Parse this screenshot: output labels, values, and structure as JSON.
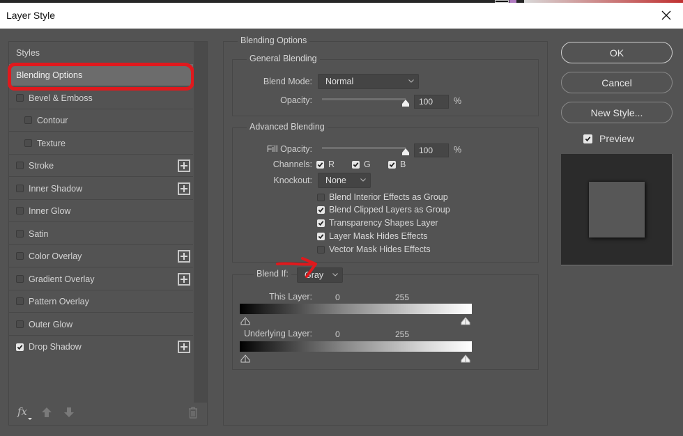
{
  "window": {
    "title": "Layer Style",
    "close_icon": "close-icon"
  },
  "sidebar": {
    "header": "Styles",
    "items": [
      {
        "label": "Blending Options",
        "type": "selected",
        "checkbox": false,
        "checked": false,
        "add": false
      },
      {
        "label": "Bevel & Emboss",
        "type": "item",
        "checkbox": true,
        "checked": false,
        "add": false
      },
      {
        "label": "Contour",
        "type": "sub",
        "checkbox": true,
        "checked": false,
        "add": false
      },
      {
        "label": "Texture",
        "type": "sub",
        "checkbox": true,
        "checked": false,
        "add": false
      },
      {
        "label": "Stroke",
        "type": "item",
        "checkbox": true,
        "checked": false,
        "add": true
      },
      {
        "label": "Inner Shadow",
        "type": "item",
        "checkbox": true,
        "checked": false,
        "add": true
      },
      {
        "label": "Inner Glow",
        "type": "item",
        "checkbox": true,
        "checked": false,
        "add": false
      },
      {
        "label": "Satin",
        "type": "item",
        "checkbox": true,
        "checked": false,
        "add": false
      },
      {
        "label": "Color Overlay",
        "type": "item",
        "checkbox": true,
        "checked": false,
        "add": true
      },
      {
        "label": "Gradient Overlay",
        "type": "item",
        "checkbox": true,
        "checked": false,
        "add": true
      },
      {
        "label": "Pattern Overlay",
        "type": "item",
        "checkbox": true,
        "checked": false,
        "add": false
      },
      {
        "label": "Outer Glow",
        "type": "item",
        "checkbox": true,
        "checked": false,
        "add": false
      },
      {
        "label": "Drop Shadow",
        "type": "item",
        "checkbox": true,
        "checked": true,
        "add": true
      }
    ],
    "footer": {
      "fx_label": "fx",
      "icons": [
        "fx-menu-icon",
        "move-up-icon",
        "move-down-icon",
        "trash-icon"
      ]
    }
  },
  "blending_options": {
    "title": "Blending Options",
    "general": {
      "title": "General Blending",
      "blend_mode_label": "Blend Mode:",
      "blend_mode_value": "Normal",
      "opacity_label": "Opacity:",
      "opacity_value": "100",
      "opacity_unit": "%",
      "opacity_fraction": 1.0
    },
    "advanced": {
      "title": "Advanced Blending",
      "fill_opacity_label": "Fill Opacity:",
      "fill_opacity_value": "100",
      "fill_opacity_unit": "%",
      "fill_opacity_fraction": 1.0,
      "channels_label": "Channels:",
      "channels": [
        {
          "label": "R",
          "checked": true
        },
        {
          "label": "G",
          "checked": true
        },
        {
          "label": "B",
          "checked": true
        }
      ],
      "knockout_label": "Knockout:",
      "knockout_value": "None",
      "options": [
        {
          "label": "Blend Interior Effects as Group",
          "checked": false
        },
        {
          "label": "Blend Clipped Layers as Group",
          "checked": true
        },
        {
          "label": "Transparency Shapes Layer",
          "checked": true
        },
        {
          "label": "Layer Mask Hides Effects",
          "checked": true
        },
        {
          "label": "Vector Mask Hides Effects",
          "checked": false
        }
      ]
    },
    "blend_if": {
      "label": "Blend If:",
      "value": "Gray",
      "this_layer": {
        "label": "This Layer:",
        "min": "0",
        "max": "255"
      },
      "underlying_layer": {
        "label": "Underlying Layer:",
        "min": "0",
        "max": "255"
      }
    }
  },
  "actions": {
    "ok": "OK",
    "cancel": "Cancel",
    "new_style": "New Style...",
    "preview_label": "Preview",
    "preview_checked": true
  },
  "annotations": {
    "highlight_color": "#e0191d"
  }
}
